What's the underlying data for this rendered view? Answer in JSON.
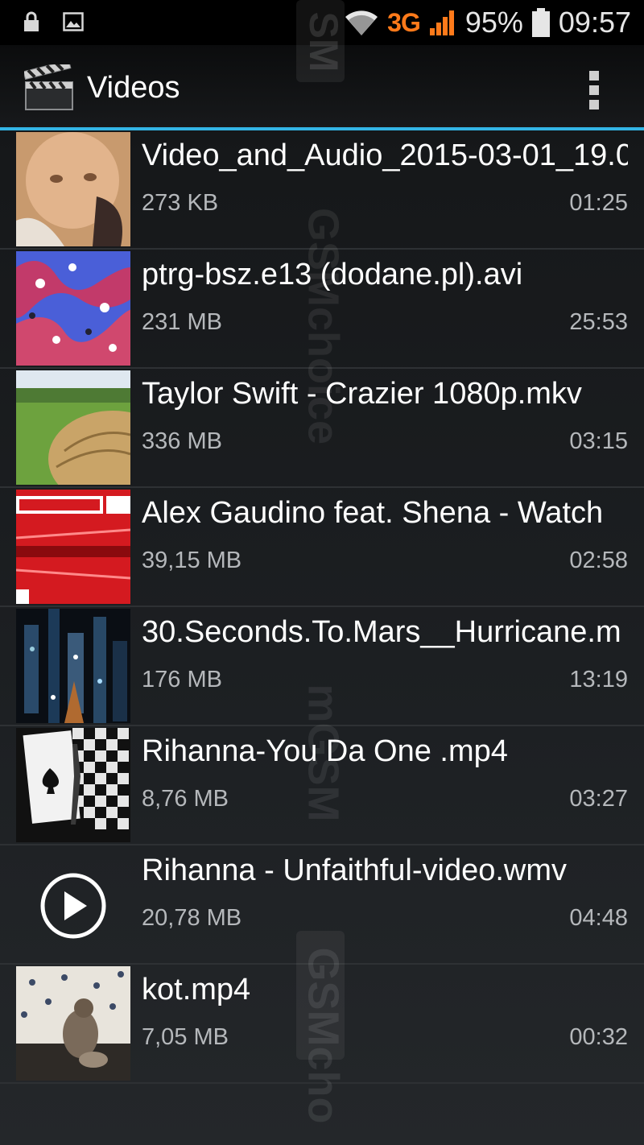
{
  "status_bar": {
    "network": "3G",
    "battery": "95%",
    "time": "09:57",
    "icons": [
      "lock-icon",
      "image-icon",
      "wifi-icon",
      "signal-icon",
      "battery-icon"
    ]
  },
  "action_bar": {
    "title": "Videos",
    "app_icon": "clapperboard-icon",
    "menu_icon": "overflow-menu-icon",
    "accent_color": "#33b5e5"
  },
  "videos": [
    {
      "name": "Video_and_Audio_2015-03-01_19.0",
      "size": "273 KB",
      "duration": "01:25"
    },
    {
      "name": "ptrg-bsz.e13 (dodane.pl).avi",
      "size": "231 MB",
      "duration": "25:53"
    },
    {
      "name": "Taylor Swift - Crazier 1080p.mkv",
      "size": "336 MB",
      "duration": "03:15"
    },
    {
      "name": "Alex Gaudino feat. Shena - Watch",
      "size": "39,15 MB",
      "duration": "02:58"
    },
    {
      "name": "30.Seconds.To.Mars__Hurricane.m",
      "size": "176 MB",
      "duration": "13:19"
    },
    {
      "name": "Rihanna-You Da One .mp4",
      "size": "8,76 MB",
      "duration": "03:27"
    },
    {
      "name": "Rihanna - Unfaithful-video.wmv",
      "size": "20,78 MB",
      "duration": "04:48"
    },
    {
      "name": "kot.mp4",
      "size": "7,05 MB",
      "duration": "00:32"
    }
  ],
  "watermark": {
    "text": "GSMchoice"
  }
}
